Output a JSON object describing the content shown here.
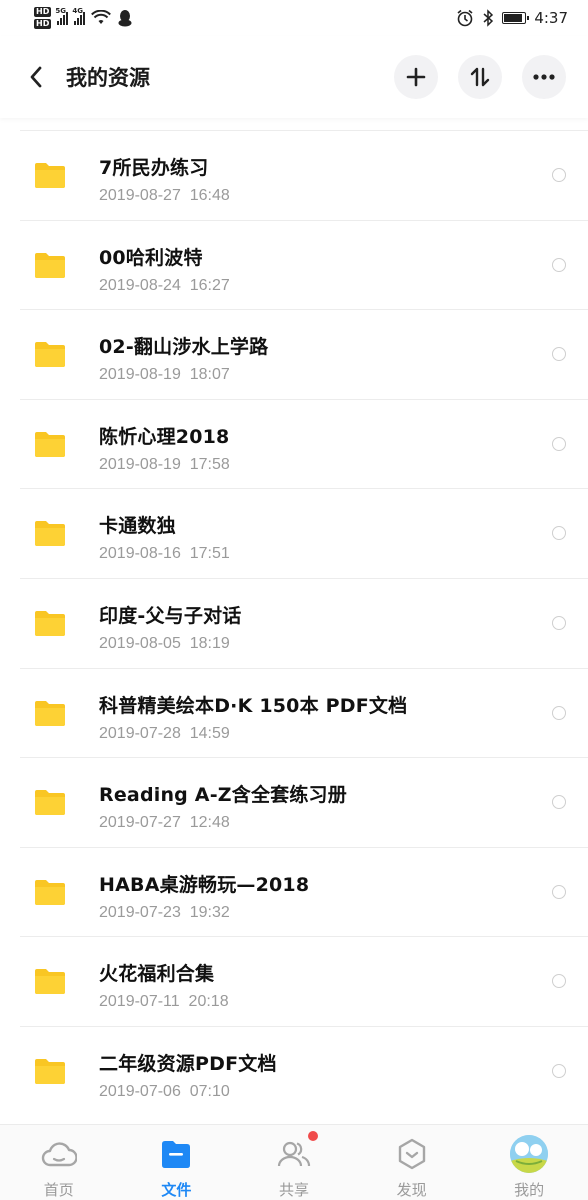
{
  "status_bar": {
    "hd1": "HD",
    "hd2": "HD",
    "sig1_tag": "5G",
    "sig2_tag": "4G",
    "time": "4:37"
  },
  "header": {
    "title": "我的资源",
    "icons": [
      "back-arrow-icon",
      "plus-icon",
      "sort-icon",
      "more-icon"
    ]
  },
  "files": [
    {
      "name": "7所民办练习",
      "date": "2019-08-27  16:48"
    },
    {
      "name": "00哈利波特",
      "date": "2019-08-24  16:27"
    },
    {
      "name": "02-翻山涉水上学路",
      "date": "2019-08-19  18:07"
    },
    {
      "name": "陈忻心理2018",
      "date": "2019-08-19  17:58"
    },
    {
      "name": "卡通数独",
      "date": "2019-08-16  17:51"
    },
    {
      "name": "印度-父与子对话",
      "date": "2019-08-05  18:19"
    },
    {
      "name": "科普精美绘本D·K 150本 PDF文档",
      "date": "2019-07-28  14:59"
    },
    {
      "name": "Reading A-Z含全套练习册",
      "date": "2019-07-27  12:48"
    },
    {
      "name": "HABA桌游畅玩—2018",
      "date": "2019-07-23  19:32"
    },
    {
      "name": "火花福利合集",
      "date": "2019-07-11  20:18"
    },
    {
      "name": "二年级资源PDF文档",
      "date": "2019-07-06  07:10"
    }
  ],
  "bottom_nav": [
    {
      "label": "首页",
      "icon": "cloud-home-icon"
    },
    {
      "label": "文件",
      "icon": "folder-icon",
      "active": true
    },
    {
      "label": "共享",
      "icon": "people-icon",
      "badge": true
    },
    {
      "label": "发现",
      "icon": "discover-icon"
    },
    {
      "label": "我的",
      "icon": "avatar"
    }
  ],
  "colors": {
    "accent": "#1e88f5",
    "folder": "#f9c623",
    "badge": "#f04b4b",
    "secondary_text": "#9a9a9a"
  }
}
